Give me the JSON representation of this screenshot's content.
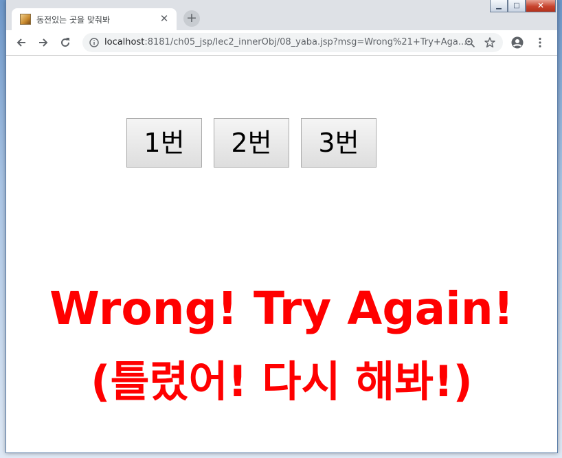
{
  "browser": {
    "tab_title": "동전있는 곳을 맞춰봐",
    "tab_close_glyph": "✕",
    "new_tab_glyph": "+",
    "url_host": "localhost",
    "url_rest": ":8181/ch05_jsp/lec2_innerObj/08_yaba.jsp?msg=Wrong%21+Try+Aga...",
    "window_controls": {
      "minimize_glyph": "▁",
      "maximize_glyph": "□",
      "close_glyph": "✕"
    },
    "icons": [
      "back-arrow-icon",
      "forward-arrow-icon",
      "reload-icon",
      "info-icon",
      "zoom-icon",
      "star-icon",
      "profile-icon",
      "menu-icon"
    ]
  },
  "page": {
    "buttons": [
      {
        "label": "1번"
      },
      {
        "label": "2번"
      },
      {
        "label": "3번"
      }
    ],
    "message_line1": "Wrong! Try Again!",
    "message_line2": "(틀렸어! 다시 해봐!)",
    "message_color": "#ff0000"
  }
}
